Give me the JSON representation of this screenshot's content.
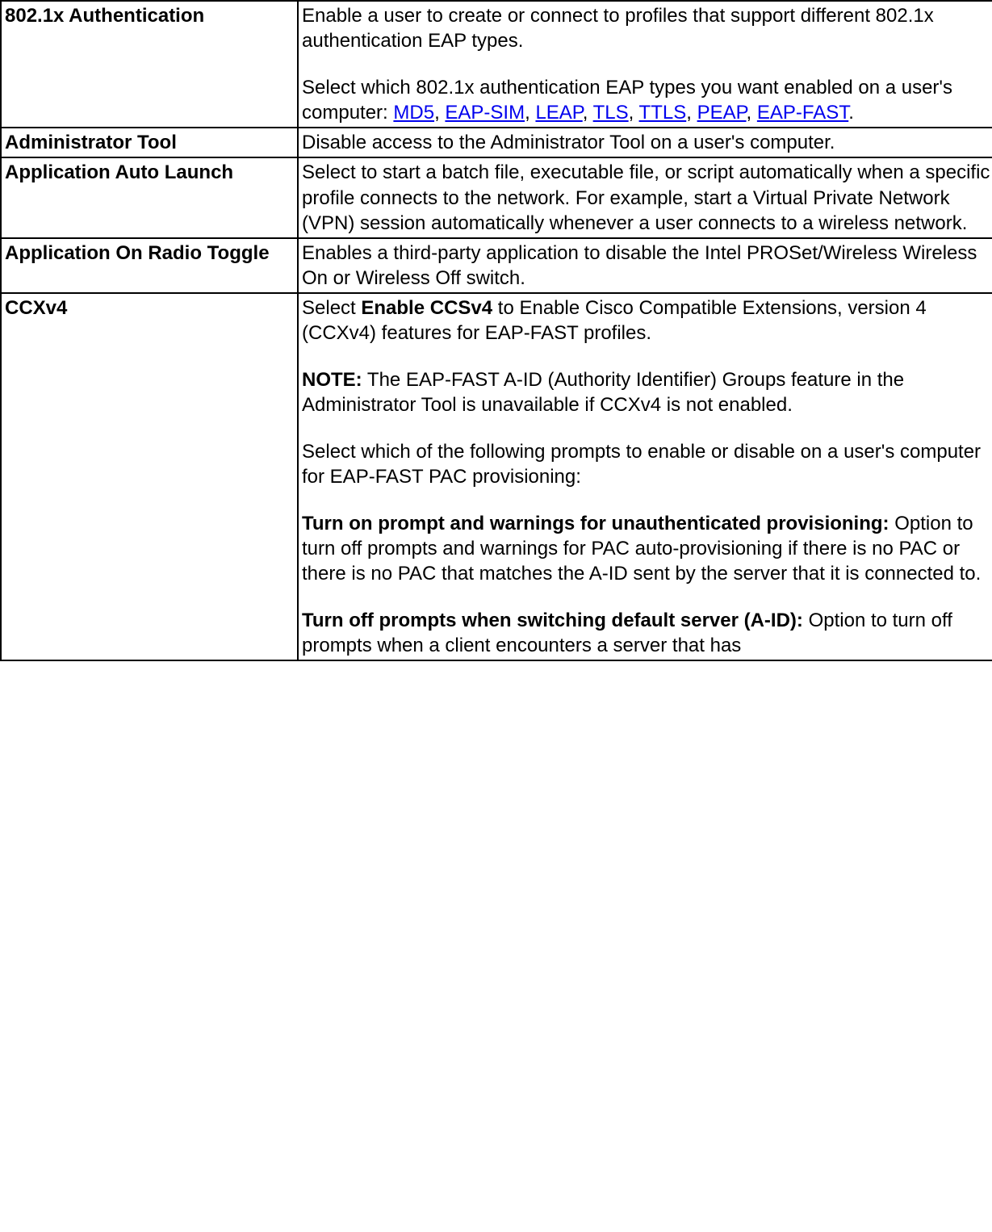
{
  "rows": {
    "r0": {
      "label": "802.1x Authentication",
      "p1": "Enable a user to create or connect to profiles that support different 802.1x authentication EAP types.",
      "p2a": "Select which 802.1x authentication EAP types you want enabled on a user's computer: ",
      "links": {
        "md5": "MD5",
        "eapsim": "EAP-SIM",
        "leap": "LEAP",
        "tls": "TLS",
        "ttls": "TTLS",
        "peap": "PEAP",
        "eapfast": "EAP-FAST"
      },
      "comma": ", ",
      "period": "."
    },
    "r1": {
      "label": "Administrator Tool",
      "p1": "Disable access to the Administrator Tool on a user's computer."
    },
    "r2": {
      "label": "Application Auto Launch",
      "p1": "Select to start a batch file, executable file, or script automatically when a specific profile connects to the network. For example, start a Virtual Private Network (VPN) session automatically whenever a user connects to a wireless network."
    },
    "r3": {
      "label": "Application On Radio Toggle",
      "p1": "Enables a third-party application to disable the Intel PROSet/Wireless Wireless On or Wireless Off switch."
    },
    "r4": {
      "label": "CCXv4",
      "p1a": "Select ",
      "p1b": "Enable CCSv4",
      "p1c": " to Enable Cisco Compatible Extensions, version 4 (CCXv4) features for EAP-FAST profiles.",
      "p2a": "NOTE:",
      "p2b": " The EAP-FAST A-ID (Authority Identifier) Groups feature in the Administrator Tool is unavailable if CCXv4 is not enabled.",
      "p3": "Select which of the following prompts to enable or disable on a user's computer for EAP-FAST PAC provisioning:",
      "p4a": "Turn on prompt and warnings for unauthenticated provisioning:",
      "p4b": " Option to turn off prompts and warnings for PAC auto-provisioning if there is no PAC or there is no PAC that matches the A-ID sent by the server that it is connected to.",
      "p5a": "Turn off prompts when switching default server (A-ID):",
      "p5b": " Option to turn off prompts when a client encounters a server that has"
    }
  }
}
